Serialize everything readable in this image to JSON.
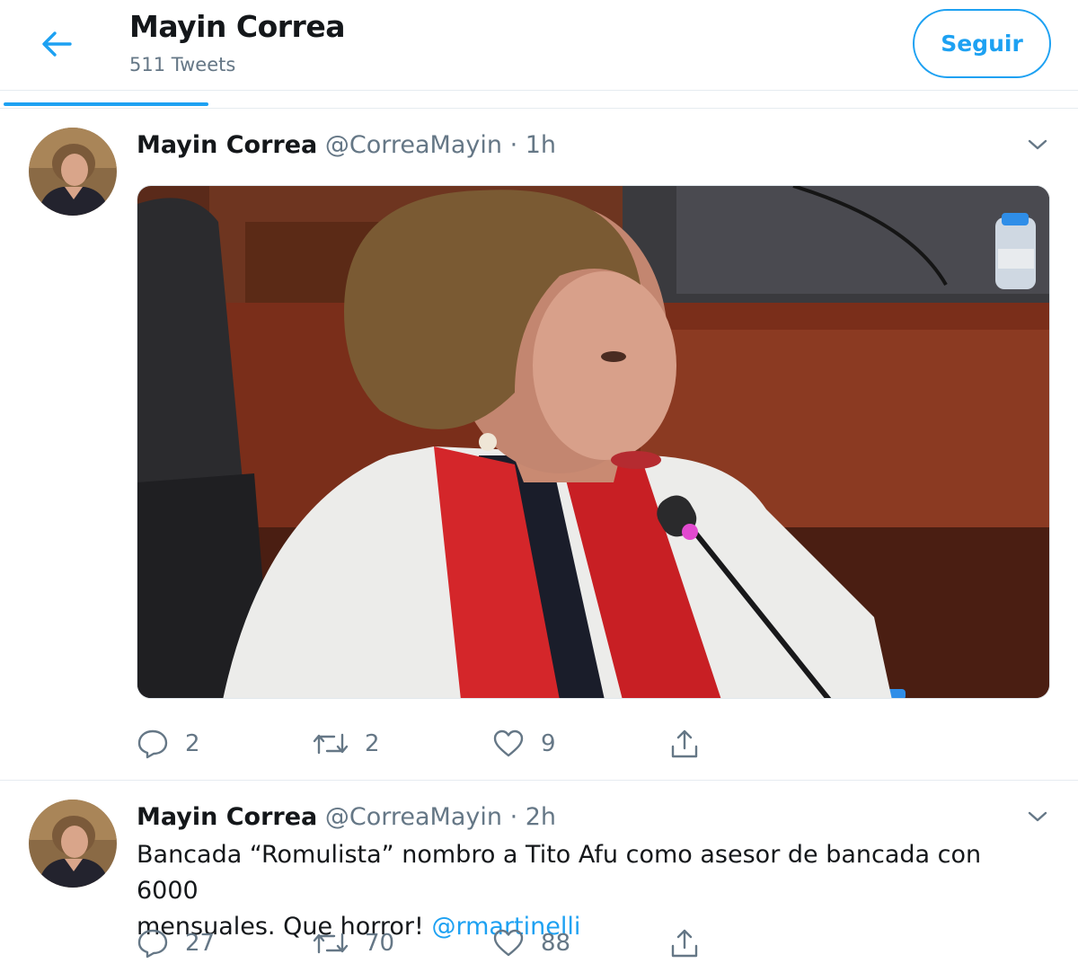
{
  "header": {
    "title": "Mayin Correa",
    "tweet_count": "511 Tweets",
    "follow_label": "Seguir"
  },
  "tweets": [
    {
      "name": "Mayin Correa",
      "handle": "@CorreaMayin",
      "dot": "·",
      "time": "1h",
      "has_media": true,
      "replies": "2",
      "retweets": "2",
      "likes": "9"
    },
    {
      "name": "Mayin Correa",
      "handle": "@CorreaMayin",
      "dot": "·",
      "time": "2h",
      "text_line1": "Bancada “Romulista” nombro a Tito Afu como asesor de bancada con 6000",
      "text_line2": "mensuales. Que horror!",
      "mention": "@rmartinelli",
      "replies": "27",
      "retweets": "70",
      "likes": "88"
    }
  ],
  "icons": {
    "back": "arrow-left-icon",
    "caret": "chevron-down-icon",
    "reply": "reply-icon",
    "retweet": "retweet-icon",
    "like": "heart-icon",
    "share": "share-icon"
  },
  "colors": {
    "accent": "#1da1f2",
    "text": "#14171a",
    "muted": "#657786",
    "divider": "#e6ecf0"
  }
}
